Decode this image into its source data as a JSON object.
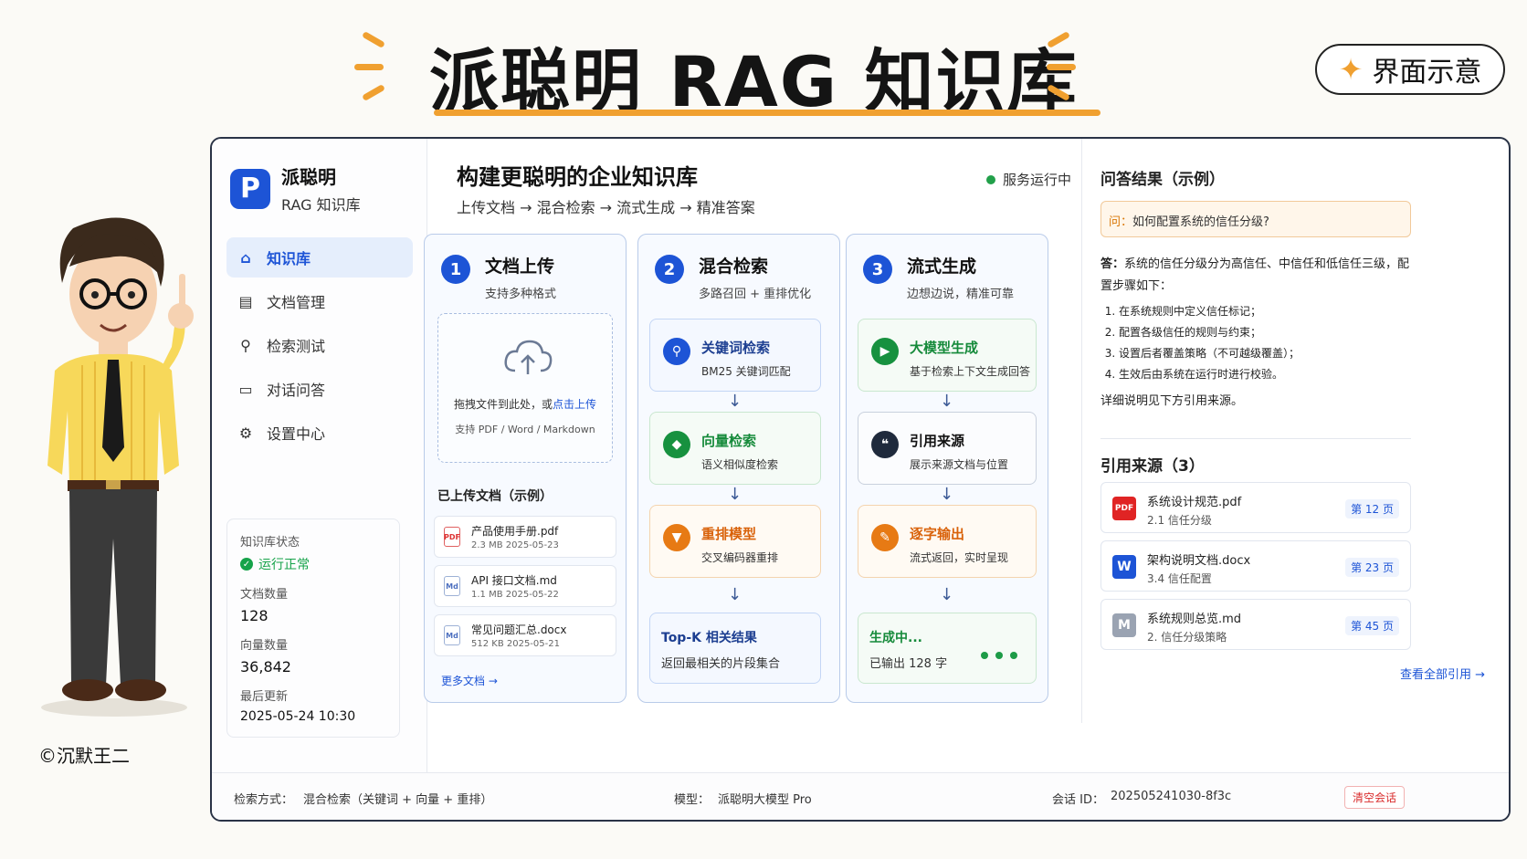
{
  "header": {
    "title": "派聪明 RAG 知识库",
    "badge": "界面示意",
    "accent": "#f0a030"
  },
  "brand": {
    "mark": "P",
    "name": "派聪明",
    "subtitle": "RAG 知识库",
    "color": "#1d54d6"
  },
  "nav": [
    {
      "label": "知识库",
      "icon": "home-icon",
      "active": true
    },
    {
      "label": "文档管理",
      "icon": "document-icon"
    },
    {
      "label": "检索测试",
      "icon": "search-icon"
    },
    {
      "label": "对话问答",
      "icon": "chat-icon"
    },
    {
      "label": "设置中心",
      "icon": "gear-icon"
    }
  ],
  "kb_status": {
    "status_label": "知识库状态",
    "status_value": "运行正常",
    "doc_count_label": "文档数量",
    "doc_count": "128",
    "vector_count_label": "向量数量",
    "vector_count": "36,842",
    "updated_label": "最后更新",
    "updated": "2025-05-24 10:30"
  },
  "main": {
    "title": "构建更聪明的企业知识库",
    "flow": "上传文档 → 混合检索 → 流式生成 → 精准答案",
    "service_status": "服务运行中"
  },
  "columns": {
    "upload": {
      "num": "1",
      "title": "文档上传",
      "subtitle": "支持多种格式",
      "drop_text": "拖拽文件到此处，或",
      "drop_link": "点击上传",
      "drop_hint": "支持 PDF / Word / Markdown",
      "uploaded_title": "已上传文档（示例）",
      "files": [
        {
          "icon": "PDF",
          "name": "产品使用手册.pdf",
          "meta": "2.3 MB   2025-05-23"
        },
        {
          "icon": "Md",
          "name": "API 接口文档.md",
          "meta": "1.1 MB   2025-05-22"
        },
        {
          "icon": "Md",
          "name": "常见问题汇总.docx",
          "meta": "512 KB   2025-05-21"
        }
      ],
      "more": "更多文档 →"
    },
    "retrieval": {
      "num": "2",
      "title": "混合检索",
      "subtitle": "多路召回 + 重排优化",
      "steps": [
        {
          "title": "关键词检索",
          "desc": "BM25 关键词匹配",
          "icon": "search-icon",
          "color": "#1d54d6"
        },
        {
          "title": "向量检索",
          "desc": "语义相似度检索",
          "icon": "cube-icon",
          "color": "#17913f"
        },
        {
          "title": "重排模型",
          "desc": "交叉编码器重排",
          "icon": "filter-icon",
          "color": "#e77a14"
        }
      ],
      "result_title": "Top-K 相关结果",
      "result_desc": "返回最相关的片段集合"
    },
    "generation": {
      "num": "3",
      "title": "流式生成",
      "subtitle": "边想边说，精准可靠",
      "steps": [
        {
          "title": "大模型生成",
          "desc": "基于检索上下文生成回答",
          "icon": "play-icon",
          "color": "#17913f"
        },
        {
          "title": "引用来源",
          "desc": "展示来源文档与位置",
          "icon": "quote-icon",
          "color": "#1f2a3c"
        },
        {
          "title": "逐字输出",
          "desc": "流式返回，实时呈现",
          "icon": "stream-icon",
          "color": "#e77a14"
        }
      ],
      "gen_title": "生成中...",
      "gen_desc": "已输出 128 字"
    }
  },
  "qa": {
    "title": "问答结果（示例）",
    "question_prefix": "问：",
    "question": "如何配置系统的信任分级?",
    "answer_prefix": "答：",
    "answer": "系统的信任分级分为高信任、中信任和低信任三级，配置步骤如下：",
    "steps": [
      "在系统规则中定义信任标记；",
      "配置各级信任的规则与约束；",
      "设置后者覆盖策略（不可越级覆盖）；",
      "生效后由系统在运行时进行校验。"
    ],
    "detail": "详细说明见下方引用来源。"
  },
  "refs": {
    "title": "引用来源（3）",
    "items": [
      {
        "icon": "PDF",
        "name": "系统设计规范.pdf",
        "section": "2.1 信任分级",
        "page": "第 12 页",
        "color": "#e02424"
      },
      {
        "icon": "W",
        "name": "架构说明文档.docx",
        "section": "3.4 信任配置",
        "page": "第 23 页",
        "color": "#1d54d6"
      },
      {
        "icon": "M",
        "name": "系统规则总览.md",
        "section": "2. 信任分级策略",
        "page": "第 45 页",
        "color": "#9aa3b2"
      }
    ],
    "see_all": "查看全部引用 →"
  },
  "footer": {
    "retrieval_label": "检索方式：",
    "retrieval_value": "混合检索（关键词 + 向量 + 重排）",
    "model_label": "模型：",
    "model_value": "派聪明大模型 Pro",
    "session_label": "会话 ID：",
    "session_value": "202505241030-8f3c",
    "clear": "清空会话"
  },
  "copyright": "©沉默王二"
}
